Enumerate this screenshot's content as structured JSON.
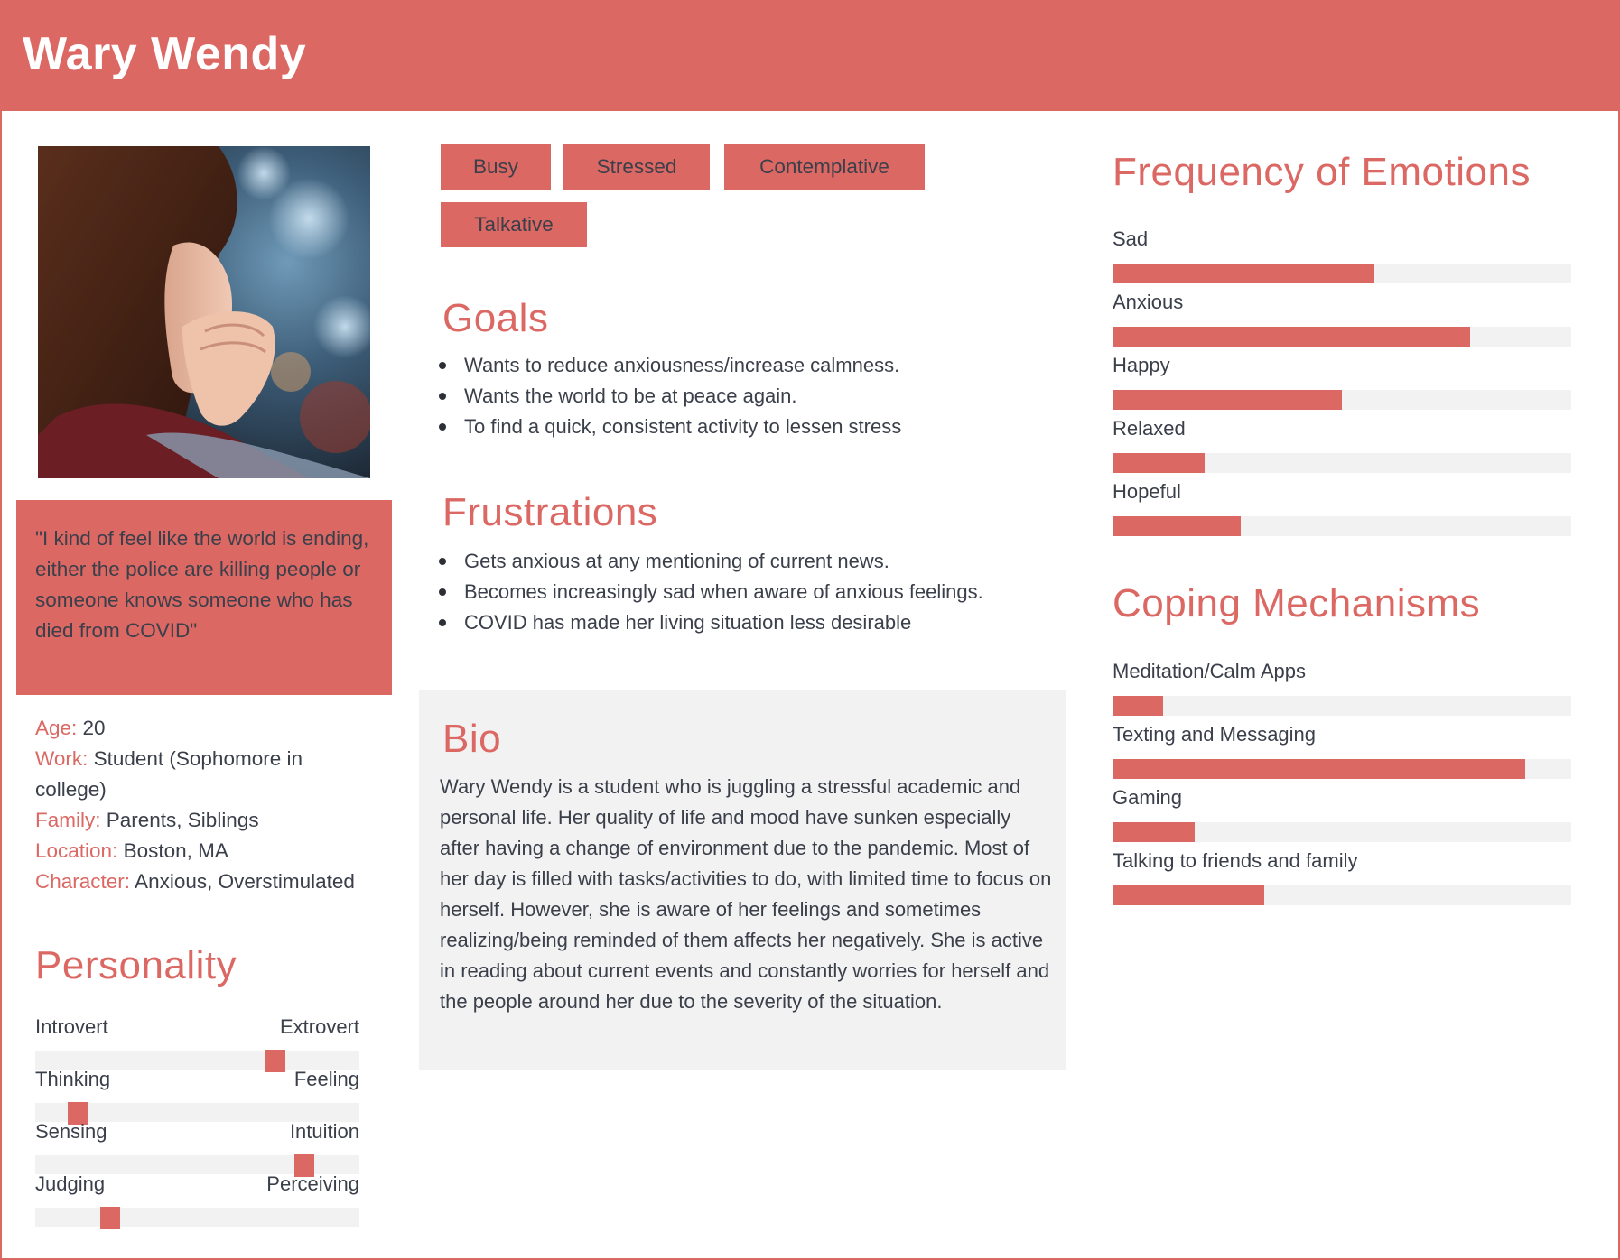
{
  "header": {
    "title": "Wary Wendy"
  },
  "profile": {
    "photo_alt": "Young woman with eyes closed resting her chin on clasped hands",
    "quote": "\"I kind of feel like the world is ending, either the police are killing people or someone knows someone who has died from COVID\"",
    "facts": [
      {
        "label": "Age:",
        "value": " 20"
      },
      {
        "label": "Work:",
        "value": " Student (Sophomore in college)"
      },
      {
        "label": "Family:",
        "value": " Parents, Siblings"
      },
      {
        "label": "Location:",
        "value": " Boston, MA"
      },
      {
        "label": "Character:",
        "value": " Anxious, Overstimulated"
      }
    ]
  },
  "personality": {
    "title": "Personality",
    "traits": [
      {
        "left": "Introvert",
        "right": "Extrovert",
        "value": 0.74
      },
      {
        "left": "Thinking",
        "right": "Feeling",
        "value": 0.13
      },
      {
        "left": "Sensing",
        "right": "Intuition",
        "value": 0.83
      },
      {
        "left": "Judging",
        "right": "Perceiving",
        "value": 0.23
      }
    ]
  },
  "tags": [
    "Busy",
    "Stressed",
    "Contemplative",
    "Talkative"
  ],
  "goals": {
    "title": "Goals",
    "items": [
      "Wants to reduce anxiousness/increase calmness.",
      "Wants the world to be at peace again.",
      "To find a quick, consistent activity to lessen stress"
    ]
  },
  "frustrations": {
    "title": "Frustrations",
    "items": [
      "Gets anxious at any mentioning of current news.",
      "Becomes increasingly sad when aware of anxious feelings.",
      "COVID has made her living situation less desirable"
    ]
  },
  "bio": {
    "title": "Bio",
    "text": "Wary Wendy is a student who is juggling a stressful academic and personal life. Her quality of life and mood have sunken especially after having a change of environment due to the pandemic. Most of her day is filled with tasks/activities to do, with limited time to focus on herself. However, she is aware of her feelings and sometimes realizing/being reminded of them affects her negatively. She is active in reading about current events and constantly worries for herself and the people around her due to the severity of the situation."
  },
  "emotions": {
    "title": "Frequency of Emotions",
    "items": [
      {
        "label": "Sad",
        "value": 0.57
      },
      {
        "label": "Anxious",
        "value": 0.78
      },
      {
        "label": "Happy",
        "value": 0.5
      },
      {
        "label": "Relaxed",
        "value": 0.2
      },
      {
        "label": "Hopeful",
        "value": 0.28
      }
    ]
  },
  "coping": {
    "title": "Coping Mechanisms",
    "items": [
      {
        "label": "Meditation/Calm Apps",
        "value": 0.11
      },
      {
        "label": "Texting and Messaging",
        "value": 0.9
      },
      {
        "label": "Gaming",
        "value": 0.18
      },
      {
        "label": "Talking to friends and family",
        "value": 0.33
      }
    ]
  },
  "colors": {
    "accent": "#dc6864",
    "track": "#f2f2f2",
    "text": "#3a3f4a"
  }
}
